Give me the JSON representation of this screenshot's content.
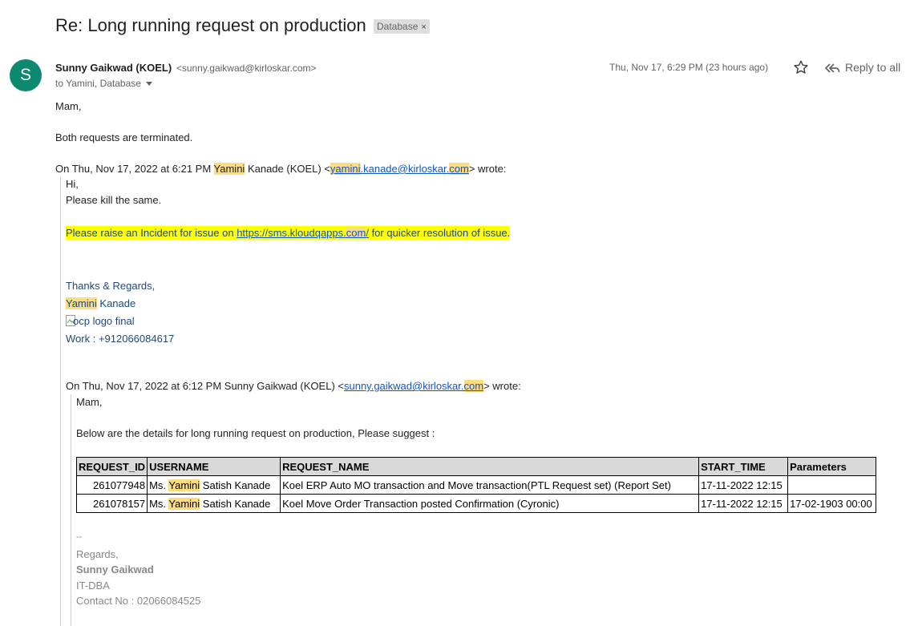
{
  "email": {
    "subject": "Re: Long running request on production",
    "label": "Database",
    "label_close": "×",
    "avatar_letter": "S",
    "sender_name": "Sunny Gaikwad (KOEL)",
    "sender_email": "<sunny.gaikwad@kirloskar.com>",
    "to_line": "to Yamini, Database",
    "date": "Thu, Nov 17, 6:29 PM (23 hours ago)",
    "reply_all_label": "Reply to all"
  },
  "body": {
    "greeting": "Mam,",
    "line1": "Both requests are terminated.",
    "quote_header": {
      "prefix": "On Thu, Nov 17, 2022 at 6:21 PM ",
      "name_hl": "Yamini",
      "mid": " Kanade (KOEL) <",
      "email_hl1": "yamini",
      "email_mid": ".kanade@kirloskar.",
      "email_hl2": "com",
      "suffix": "> wrote:"
    },
    "q1_hi": "Hi,",
    "q1_line": "Please kill the same.",
    "q1_incident_pre": "Please raise an Incident for issue on  ",
    "q1_incident_link_a": "https://sms.kloudqapps.",
    "q1_incident_link_b": "com",
    "q1_incident_link_c": "/",
    "q1_incident_post": " for quicker resolution of issue.",
    "q1_thanks": "Thanks & Regards,",
    "q1_sig_name_hl": "Yamini",
    "q1_sig_name_rest": " Kanade",
    "q1_logo_alt": "ocp logo final",
    "q1_work_label": "Work :  ",
    "q1_work_phone": "+912066084617",
    "quote2_header": {
      "prefix": "On Thu, Nov 17, 2022 at 6:12 PM Sunny Gaikwad (KOEL) <",
      "email_main": "sunny.gaikwad@kirloskar.",
      "email_hl": "com",
      "suffix": "> wrote:"
    },
    "q2_greeting": "Mam,",
    "q2_line": "Below are the details for long running request on production, Please suggest :",
    "table": {
      "headers": [
        "REQUEST_ID",
        "USERNAME",
        "REQUEST_NAME",
        "START_TIME",
        "Parameters"
      ],
      "rows": [
        {
          "id": "261077948",
          "user_pre": "Ms. ",
          "user_hl": "Yamini",
          "user_post": " Satish Kanade",
          "name": "Koel ERP Auto MO transaction and Move transaction(PTL Request set) (Report Set)",
          "start": "17-11-2022 12:15",
          "params": ""
        },
        {
          "id": "261078157",
          "user_pre": "Ms. ",
          "user_hl": "Yamini",
          "user_post": " Satish Kanade",
          "name": "Koel Move Order Transaction posted Confirmation (Cyronic)",
          "start": "17-11-2022 12:15",
          "params": "17-02-1903 00:00"
        }
      ]
    },
    "sig2_dashes": "--",
    "sig2_regards": "Regards,",
    "sig2_name": "Sunny Gaikwad",
    "sig2_dept": "IT-DBA",
    "sig2_contact": "Contact No : 02066084525"
  }
}
